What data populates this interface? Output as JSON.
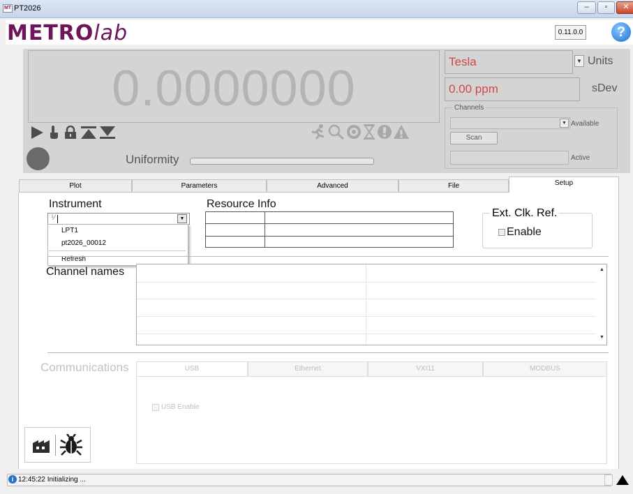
{
  "window": {
    "title": "PT2026",
    "minimize_icon": "minimize-icon",
    "maximize_icon": "maximize-icon",
    "close_icon": "close-icon"
  },
  "header": {
    "logo_bold": "METRO",
    "logo_italic": "lab",
    "version": "0.11.0.0",
    "help_icon": "help-icon"
  },
  "display": {
    "value": "0.0000000",
    "uniformity_label": "Uniformity",
    "uniformity_level": 0,
    "units_value": "Tesla",
    "units_label": "Units",
    "sdev_value": "0.00 ppm",
    "sdev_label": "sDev",
    "channels_label": "Channels",
    "available_value": "",
    "available_label": "Available",
    "scan_label": "Scan",
    "active_value": "",
    "active_label": "Active",
    "control_icons": [
      "play-icon",
      "touch-icon",
      "lock-icon",
      "scroll-top-icon",
      "scroll-bottom-icon"
    ],
    "status_icons": [
      "running-icon",
      "search-icon",
      "gauge-icon",
      "hourglass-icon",
      "error-icon",
      "warning-icon"
    ],
    "colors": {
      "panel": "#d4d4d4",
      "value": "#b4b4b4",
      "red": "#d04848"
    }
  },
  "tabs": [
    {
      "label": "Plot",
      "active": false
    },
    {
      "label": "Parameters",
      "active": false
    },
    {
      "label": "Advanced",
      "active": false
    },
    {
      "label": "File",
      "active": false
    },
    {
      "label": "Setup",
      "active": true
    }
  ],
  "setup": {
    "instrument_label": "Instrument",
    "instrument_options": [
      "LPT1",
      "pt2026_00012"
    ],
    "instrument_refresh": "Refresh",
    "resource_info_label": "Resource Info",
    "ext_clk_label": "Ext. Clk. Ref.",
    "enable_label": "Enable",
    "channel_names_label": "Channel names",
    "communications_label": "Communications",
    "comm_tabs": [
      "USB",
      "Ethernet",
      "VXI11",
      "MODBUS"
    ],
    "usb_enable_label": "USB Enable",
    "bottom_icons": [
      "factory-icon",
      "bug-icon"
    ]
  },
  "status": {
    "text": "12:45:22 Initializing ...",
    "icon": "info-icon",
    "expand_icon": "expand-up-icon"
  }
}
